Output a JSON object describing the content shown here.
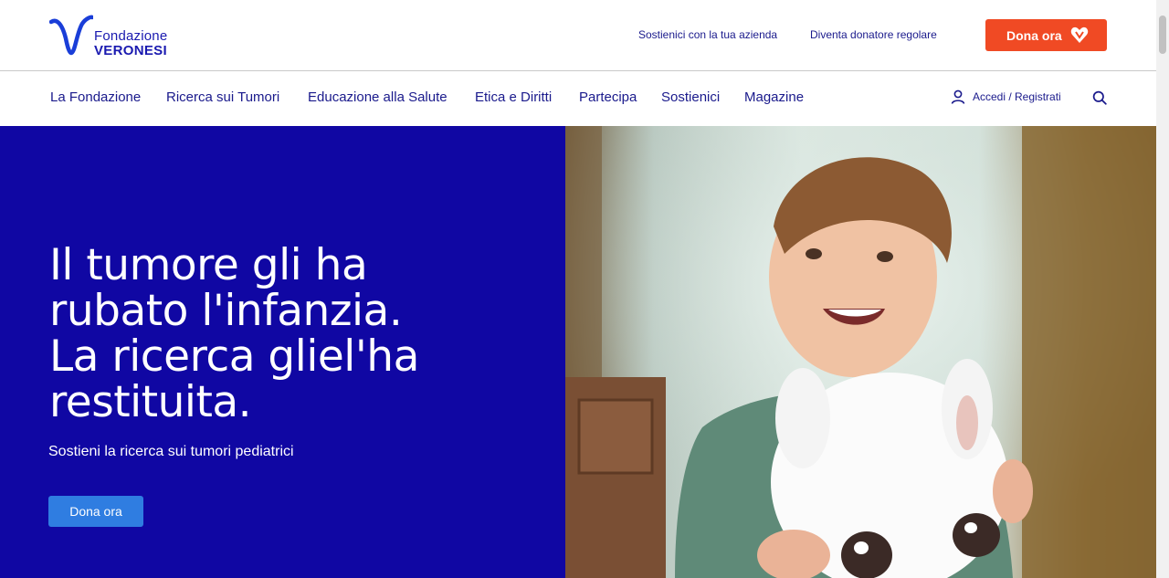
{
  "brand": {
    "line1": "Fondazione",
    "line2": "VERONESI",
    "color": "#1a1ab0"
  },
  "top_links": [
    "Sostienici con la tua azienda",
    "Diventa donatore regolare"
  ],
  "donate_top": {
    "label": "Dona ora",
    "icon": "heart-icon",
    "color": "#f04a24"
  },
  "nav": {
    "items": [
      "La Fondazione",
      "Ricerca sui Tumori",
      "Educazione alla Salute",
      "Etica e Diritti",
      "Partecipa",
      "Sostienici",
      "Magazine"
    ],
    "login_label": "Accedi / Registrati",
    "login_icon": "user-icon",
    "search_icon": "search-icon"
  },
  "hero": {
    "title_lines": [
      "Il tumore gli ha",
      "rubato l'infanzia.",
      "La ricerca gliel'ha",
      "restituita."
    ],
    "subtitle": "Sostieni la ricerca sui tumori pediatrici",
    "button": "Dona ora",
    "bg_color": "#1007a3",
    "button_color": "#2f7de1"
  }
}
